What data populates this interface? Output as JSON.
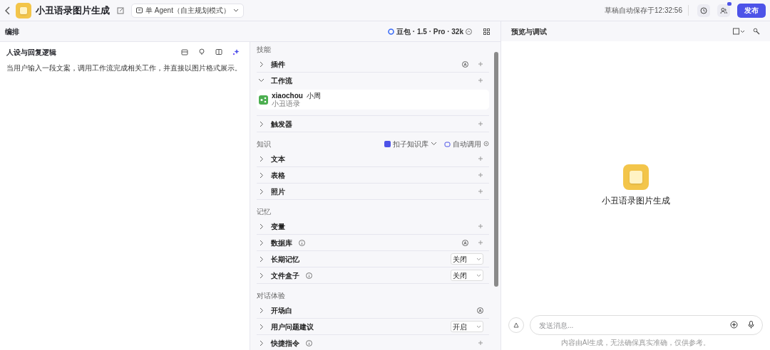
{
  "header": {
    "app_name": "小丑语录图片生成",
    "mode": "单 Agent（自主规划模式）",
    "save_status": "草稿自动保存于12:32:56",
    "has_notification": true,
    "publish": "发布"
  },
  "arrange": {
    "title": "编排",
    "model": "豆包 · 1.5 · Pro · 32k"
  },
  "persona": {
    "title": "人设与回复逻辑",
    "text": "当用户输入一段文案，调用工作流完成相关工作，并直接以图片格式展示。"
  },
  "sections": [
    {
      "title": "技能",
      "rows": [
        {
          "label": "插件",
          "expanded": false,
          "info": false,
          "auto": true,
          "plus": true
        },
        {
          "label": "工作流",
          "expanded": true,
          "info": false,
          "auto": false,
          "plus": true,
          "items": [
            {
              "name": "xiaochou",
              "tag": "小周",
              "desc": "小丑语录"
            }
          ]
        },
        {
          "label": "触发器",
          "expanded": false,
          "info": false,
          "auto": false,
          "plus": true
        }
      ]
    },
    {
      "title": "知识",
      "source": "扣子知识库",
      "call_mode": "自动调用",
      "rows": [
        {
          "label": "文本",
          "expanded": false,
          "info": false,
          "auto": false,
          "plus": true
        },
        {
          "label": "表格",
          "expanded": false,
          "info": false,
          "auto": false,
          "plus": true
        },
        {
          "label": "照片",
          "expanded": false,
          "info": false,
          "auto": false,
          "plus": true
        }
      ]
    },
    {
      "title": "记忆",
      "rows": [
        {
          "label": "变量",
          "expanded": false,
          "info": false,
          "auto": false,
          "plus": true
        },
        {
          "label": "数据库",
          "expanded": false,
          "info": true,
          "auto": true,
          "plus": true
        },
        {
          "label": "长期记忆",
          "expanded": false,
          "info": false,
          "auto": false,
          "plus": false,
          "select": "关闭"
        },
        {
          "label": "文件盒子",
          "expanded": false,
          "info": true,
          "auto": false,
          "plus": false,
          "select": "关闭"
        }
      ]
    },
    {
      "title": "对话体验",
      "rows": [
        {
          "label": "开场白",
          "expanded": false,
          "info": false,
          "auto": true,
          "plus": false
        },
        {
          "label": "用户问题建议",
          "expanded": false,
          "info": false,
          "auto": false,
          "plus": false,
          "select": "开启"
        },
        {
          "label": "快捷指令",
          "expanded": false,
          "info": true,
          "auto": false,
          "plus": true
        }
      ]
    }
  ],
  "preview": {
    "title": "预览与调试",
    "app_name": "小丑语录图片生成",
    "placeholder": "发送消息...",
    "disclaimer": "内容由AI生成，无法确保真实准确，仅供参考。"
  }
}
